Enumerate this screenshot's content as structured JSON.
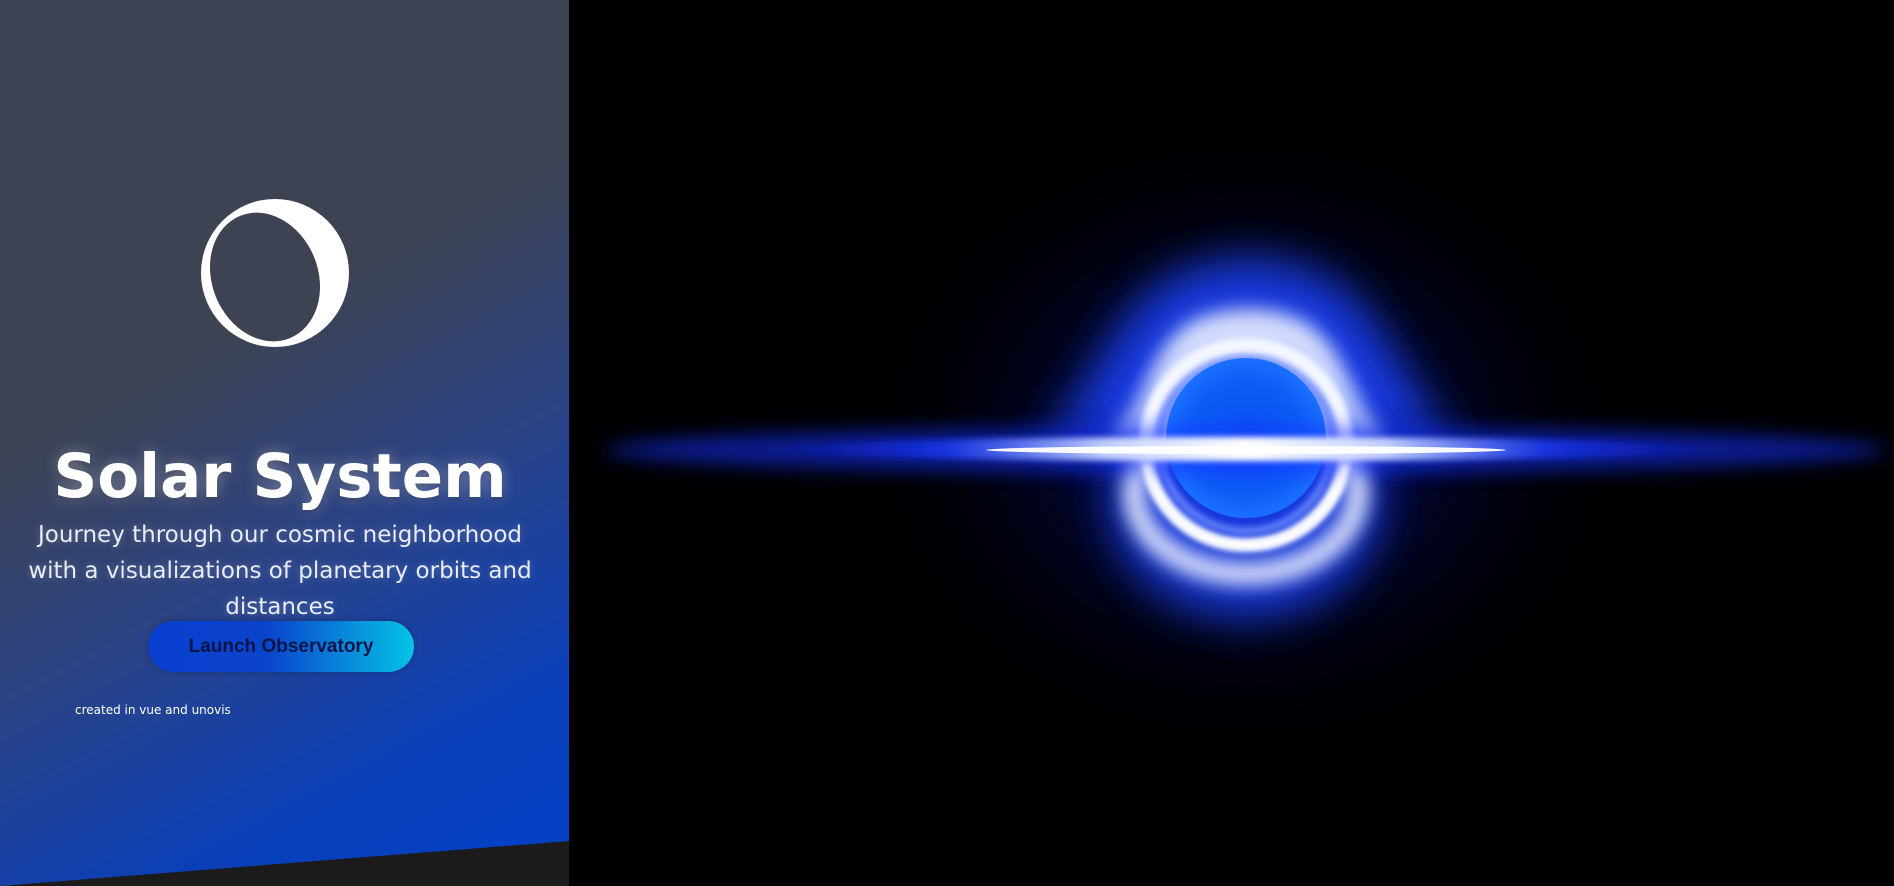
{
  "hero": {
    "title": "Solar System",
    "subtitle": "Journey through our cosmic neighborhood with a visualizations of planetary orbits and distances",
    "launch_label": "Launch Observatory",
    "credit": "created in vue and unovis"
  },
  "icons": {
    "logo": "moon-icon"
  },
  "colors": {
    "panel_gray": "#3d4352",
    "panel_blue": "#0040c8",
    "button_start": "#0a3fd0",
    "button_end": "#04c3e6",
    "button_text": "#0b1547",
    "glow_blue": "#1a3cff",
    "background": "#000003"
  }
}
